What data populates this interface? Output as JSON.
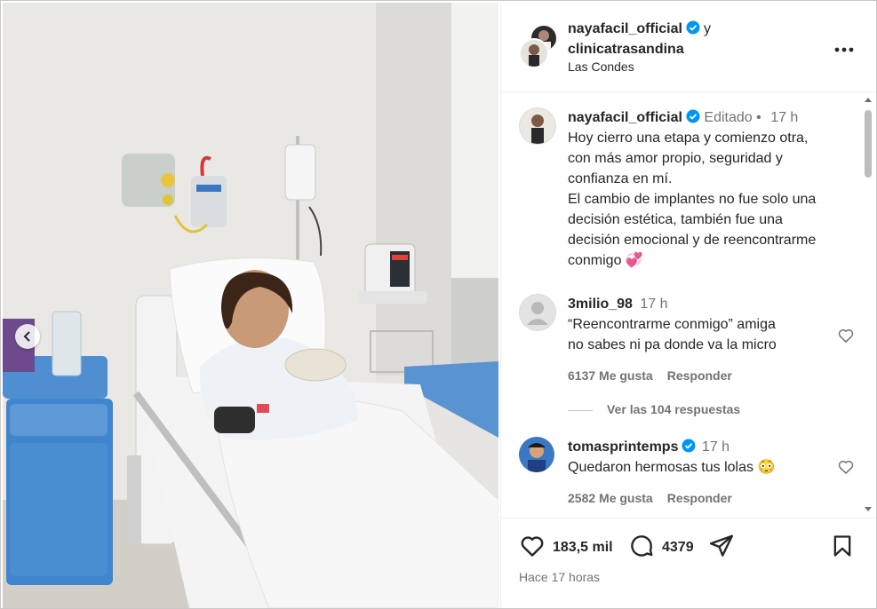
{
  "header": {
    "user1": "nayafacil_official",
    "conj": "y",
    "user2": "clinicatrasandina",
    "location": "Las Condes",
    "more_icon": "more-horizontal-icon"
  },
  "caption": {
    "username": "nayafacil_official",
    "edited": "Editado",
    "dot": "•",
    "time": "17 h",
    "lines": [
      "Hoy cierro una etapa y comienzo otra,",
      "con más amor propio, seguridad y",
      "confianza en mí.",
      "El cambio de implantes no fue solo una",
      "decisión estética, también fue una",
      "decisión emocional y de reencontrarme",
      "conmigo 💞"
    ]
  },
  "comments": [
    {
      "username": "3milio_98",
      "time": "17 h",
      "text_line1": "“Reencontrarme conmigo” amiga",
      "text_line2": "no sabes ni pa donde va la micro",
      "likes": "6137 Me gusta",
      "reply": "Responder",
      "view_replies": "Ver las 104 respuestas"
    },
    {
      "username": "tomasprintemps",
      "time": "17 h",
      "text": "Quedaron hermosas tus lolas 😳",
      "likes": "2582 Me gusta",
      "reply": "Responder"
    }
  ],
  "actions": {
    "likes": "183,5 mil",
    "comments": "4379",
    "posted": "Hace 17 horas"
  },
  "colors": {
    "verified": "#0095f6",
    "text": "#262626",
    "muted": "#737373"
  }
}
